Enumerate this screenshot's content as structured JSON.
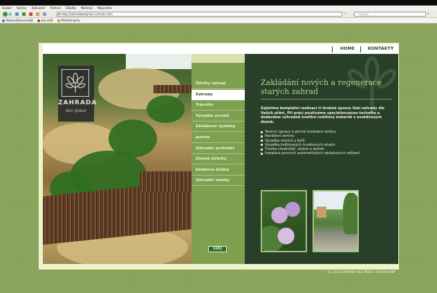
{
  "browser": {
    "menu": [
      "Soubor",
      "Úpravy",
      "Zobrazení",
      "Historie",
      "Záložky",
      "Nástroje",
      "Nápověda"
    ],
    "url": "http://zahradabezprace.cz/index.htm",
    "search_placeholder": "Google",
    "bookmarks": [
      "Nejnavštěvovanější",
      "Jak začít",
      "Přehled zpráv"
    ]
  },
  "topnav": {
    "home": "HOME",
    "contacts": "KONTAKTY"
  },
  "logo": {
    "name": "ZAHRADA",
    "tagline": "bez práce"
  },
  "menu": {
    "items": [
      {
        "label": "Údržby zahrad",
        "active": false
      },
      {
        "label": "Zahrady",
        "active": true
      },
      {
        "label": "Trávníky",
        "active": false
      },
      {
        "label": "Výsadba stromů",
        "active": false
      },
      {
        "label": "Závlahové systémy",
        "active": false
      },
      {
        "label": "Jezírka",
        "active": false
      },
      {
        "label": "Zahradní architekt",
        "active": false
      },
      {
        "label": "Zelené střechy",
        "active": false
      },
      {
        "label": "Zámková dlažba",
        "active": false
      },
      {
        "label": "Zahradní stavby",
        "active": false
      }
    ]
  },
  "counter": "1682",
  "content": {
    "heading": "Zakládání nových a regenerace starých zahrad",
    "intro": "Zajistíme kompletní realizaci či drobné úpravy Vaší zahrady dle Vašich přání. Při práci používáme specializovanou techniku a dodáváme výhradně kvalitní rostlinný materiál z osvědčených školek.",
    "services": [
      "Terénní úpravy a jemná modulace terénu",
      "Navážení zeminy",
      "Výsadba stromů a keřů",
      "Výsadba květinových trvalkových skupin",
      "Tvorba chodníčků, skalek a jezírek",
      "Instalace pevných automatických závlahových zařízení"
    ]
  },
  "footer": "(C) 2010 ZAHRADA BEZ PRÁCE / DESIGN MBP",
  "colors": {
    "page_bg": "#89a55c",
    "menu_bg": "#7ea150",
    "content_bg": "#28402a",
    "heading": "#b8cf8c"
  }
}
